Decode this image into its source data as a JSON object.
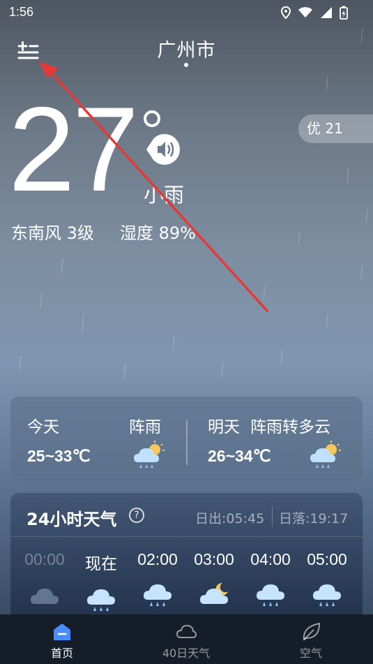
{
  "status_bar": {
    "time": "1:56"
  },
  "header": {
    "city": "广州市"
  },
  "current": {
    "temperature": "27",
    "condition": "小雨",
    "wind": "东南风 3级",
    "humidity": "湿度 89%",
    "aqi": "优 21"
  },
  "forecast": {
    "today": {
      "label": "今天",
      "condition": "阵雨",
      "range": "25~33℃",
      "icon": "rain-sun-icon"
    },
    "tomorrow": {
      "label": "明天",
      "condition": "阵雨转多云",
      "range": "26~34℃",
      "icon": "rain-sun-icon"
    }
  },
  "hourly": {
    "title": "24小时天气",
    "sunrise": "日出:05:45",
    "sunset": "日落:19:17",
    "items": [
      {
        "time": "00:00",
        "icon": "cloud-icon"
      },
      {
        "time": "现在",
        "icon": "rain-cloud-icon"
      },
      {
        "time": "02:00",
        "icon": "rain-cloud-icon"
      },
      {
        "time": "03:00",
        "icon": "moon-cloud-icon"
      },
      {
        "time": "04:00",
        "icon": "rain-cloud-icon"
      },
      {
        "time": "05:00",
        "icon": "rain-cloud-icon"
      }
    ]
  },
  "nav": {
    "home": "首页",
    "forty_day": "40日天气",
    "air": "空气"
  },
  "colors": {
    "accent_blue": "#4a8cff",
    "nav_bg": "#141d28"
  }
}
